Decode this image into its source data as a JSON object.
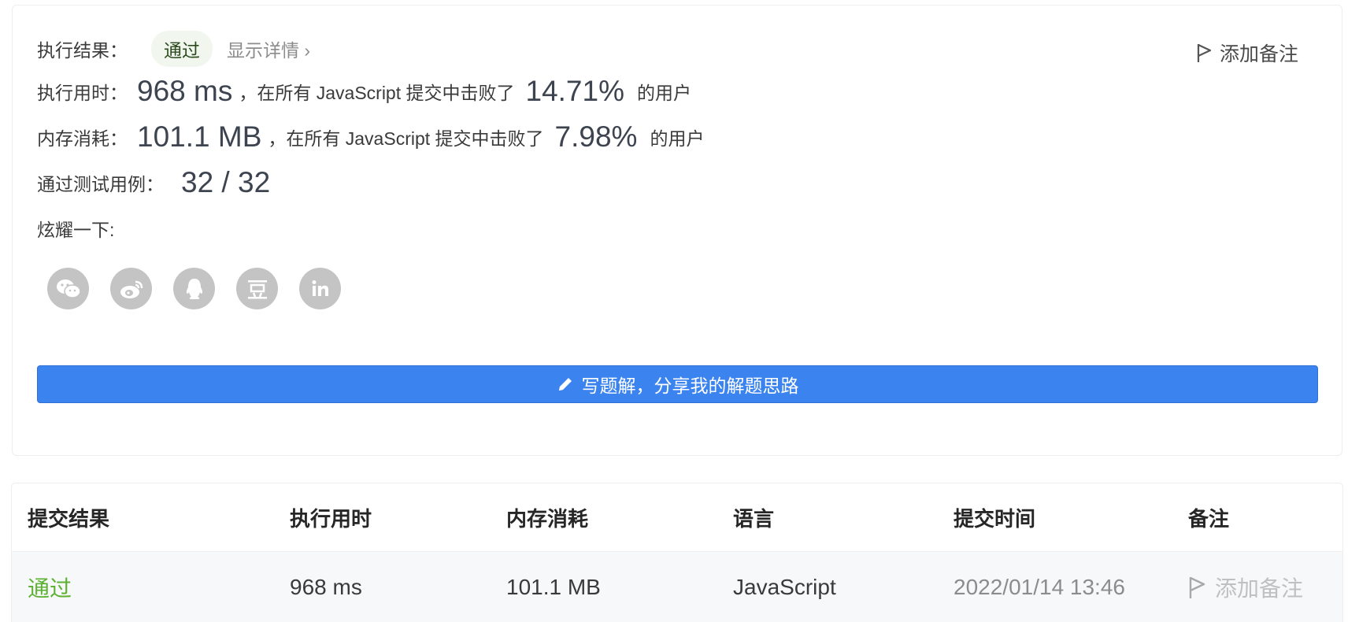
{
  "result": {
    "exec_result_label": "执行结果：",
    "status_badge": "通过",
    "show_details": "显示详情 ›",
    "add_note": "添加备注"
  },
  "runtime": {
    "label": "执行用时：",
    "value": "968 ms",
    "prefix": "，在所有 JavaScript 提交中击败了",
    "percent": "14.71%",
    "suffix": "的用户"
  },
  "memory": {
    "label": "内存消耗：",
    "value": "101.1 MB",
    "prefix": "，在所有 JavaScript 提交中击败了",
    "percent": "7.98%",
    "suffix": "的用户"
  },
  "testcases": {
    "label": "通过测试用例：",
    "value": "32 / 32"
  },
  "share": {
    "label": "炫耀一下:",
    "icons": [
      "wechat-icon",
      "weibo-icon",
      "qq-icon",
      "douban-icon",
      "linkedin-icon"
    ]
  },
  "write_solution": {
    "label": "写题解，分享我的解题思路"
  },
  "table": {
    "headers": [
      "提交结果",
      "执行用时",
      "内存消耗",
      "语言",
      "提交时间",
      "备注"
    ],
    "rows": [
      {
        "status": "通过",
        "runtime": "968 ms",
        "memory": "101.1 MB",
        "language": "JavaScript",
        "time": "2022/01/14 13:46",
        "note": "添加备注"
      }
    ]
  },
  "colors": {
    "accent": "#3b83ef",
    "pass_green": "#5cb132",
    "icon_gray": "#c4c4c4"
  }
}
